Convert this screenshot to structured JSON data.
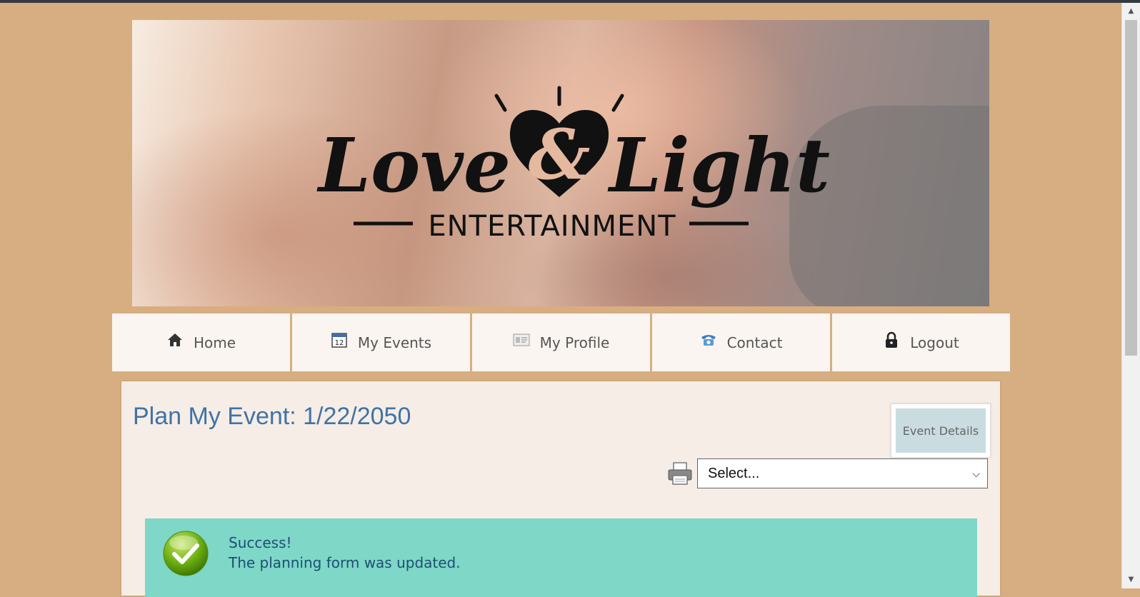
{
  "banner": {
    "brand_word_1": "Love",
    "brand_ampersand": "&",
    "brand_word_2": "Light",
    "brand_subtitle": "ENTERTAINMENT"
  },
  "nav": {
    "items": [
      {
        "label": "Home",
        "icon": "home-icon"
      },
      {
        "label": "My Events",
        "icon": "calendar-icon"
      },
      {
        "label": "My Profile",
        "icon": "profile-card-icon"
      },
      {
        "label": "Contact",
        "icon": "telephone-icon"
      },
      {
        "label": "Logout",
        "icon": "lock-icon"
      }
    ]
  },
  "main": {
    "title": "Plan My Event: 1/22/2050",
    "event_details_label": "Event Details",
    "select_value": "Select...",
    "alert": {
      "title": "Success!",
      "message": "The planning form was updated."
    }
  },
  "colors": {
    "page_background": "#d7ae81",
    "title": "#3f73a6",
    "alert_background": "#7ed7c7"
  }
}
